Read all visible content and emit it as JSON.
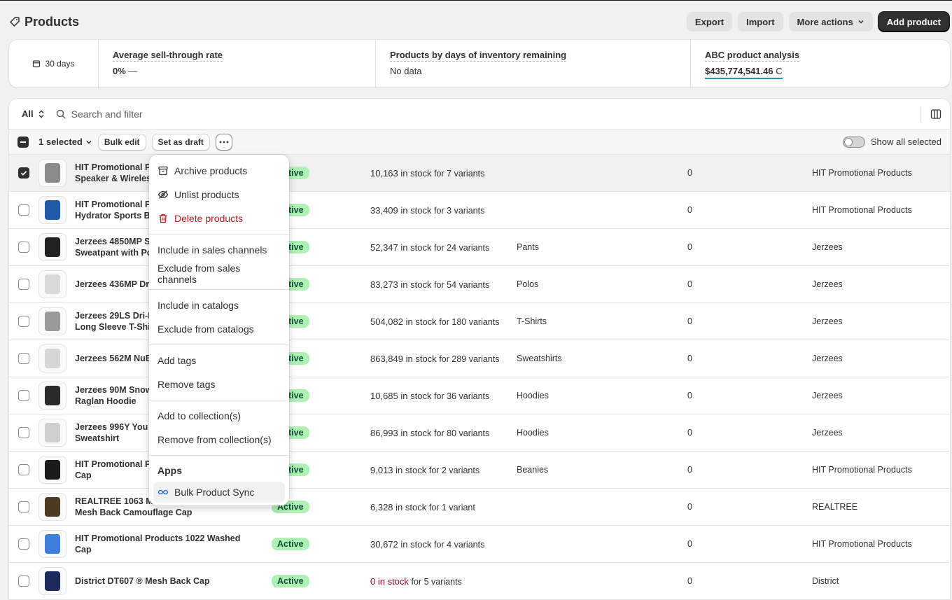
{
  "header": {
    "title": "Products",
    "export": "Export",
    "import": "Import",
    "more_actions": "More actions",
    "add_product": "Add product"
  },
  "metrics": {
    "period": "30 days",
    "sell_through_label": "Average sell-through rate",
    "sell_through_value": "0%",
    "sell_through_trend": "—",
    "days_inventory_label": "Products by days of inventory remaining",
    "days_inventory_value": "No data",
    "abc_label": "ABC product analysis",
    "abc_value": "$435,774,541.46",
    "abc_suffix": "C"
  },
  "filter": {
    "view_tab": "All",
    "search_placeholder": "Search and filter"
  },
  "bulk": {
    "selected": "1 selected",
    "bulk_edit": "Bulk edit",
    "set_draft": "Set as draft",
    "show_all": "Show all selected"
  },
  "rows": [
    {
      "name": "HIT Promotional Pr\nSpeaker & Wireles",
      "status": "Active",
      "stock": "10,163 in stock",
      "variants": "for 7 variants",
      "type": "",
      "channels": "0",
      "vendor": "HIT Promotional Products",
      "selected": true,
      "color": "#8a8a8a"
    },
    {
      "name": "HIT Promotional Pr\nHydrator Sports Bo",
      "status": "Active",
      "stock": "33,409 in stock",
      "variants": "for 3 variants",
      "type": "",
      "channels": "0",
      "vendor": "HIT Promotional Products",
      "selected": false,
      "color": "#1f5aa6"
    },
    {
      "name": "Jerzees 4850MP S\nSweatpant with Po",
      "status": "Active",
      "stock": "52,347 in stock",
      "variants": "for 24 variants",
      "type": "Pants",
      "channels": "0",
      "vendor": "Jerzees",
      "selected": false,
      "color": "#222222"
    },
    {
      "name": "Jerzees 436MP Dr",
      "status": "Active",
      "stock": "83,273 in stock",
      "variants": "for 54 variants",
      "type": "Polos",
      "channels": "0",
      "vendor": "Jerzees",
      "selected": false,
      "color": "#d9d9d9"
    },
    {
      "name": "Jerzees 29LS Dri-P\nLong Sleeve T-Shi",
      "status": "Active",
      "stock": "504,082 in stock",
      "variants": "for 180 variants",
      "type": "T-Shirts",
      "channels": "0",
      "vendor": "Jerzees",
      "selected": false,
      "color": "#9a9a9a"
    },
    {
      "name": "Jerzees 562M NuB",
      "status": "Active",
      "stock": "863,849 in stock",
      "variants": "for 289 variants",
      "type": "Sweatshirts",
      "channels": "0",
      "vendor": "Jerzees",
      "selected": false,
      "color": "#d6d6d6"
    },
    {
      "name": "Jerzees 90M Snow\nRaglan Hoodie",
      "status": "Active",
      "stock": "10,685 in stock",
      "variants": "for 36 variants",
      "type": "Hoodies",
      "channels": "0",
      "vendor": "Jerzees",
      "selected": false,
      "color": "#2b2b2b"
    },
    {
      "name": "Jerzees 996Y You\nSweatshirt",
      "status": "Active",
      "stock": "86,993 in stock",
      "variants": "for 80 variants",
      "type": "Hoodies",
      "channels": "0",
      "vendor": "Jerzees",
      "selected": false,
      "color": "#cfcfcf"
    },
    {
      "name": "HIT Promotional Pr\nCap",
      "status": "Active",
      "stock": "9,013 in stock",
      "variants": "for 2 variants",
      "type": "Beanies",
      "channels": "0",
      "vendor": "HIT Promotional Products",
      "selected": false,
      "color": "#1a1a1a"
    },
    {
      "name": "REALTREE 1063 Mo\nMesh Back Camouflage Cap",
      "status": "Active",
      "stock": "6,328 in stock",
      "variants": "for 1 variant",
      "type": "",
      "channels": "0",
      "vendor": "REALTREE",
      "selected": false,
      "color": "#4a3b22"
    },
    {
      "name": "HIT Promotional Products 1022 Washed Cap",
      "status": "Active",
      "stock": "30,672 in stock",
      "variants": "for 4 variants",
      "type": "",
      "channels": "0",
      "vendor": "HIT Promotional Products",
      "selected": false,
      "color": "#3d7fd6"
    },
    {
      "name": "District DT607 ® Mesh Back Cap",
      "status": "Active",
      "stock": "0 in stock",
      "variants": "for 5 variants",
      "type": "",
      "channels": "0",
      "vendor": "District",
      "selected": false,
      "color": "#1e2a5a",
      "zero": true
    }
  ],
  "menu": {
    "archive": "Archive products",
    "unlist": "Unlist products",
    "delete": "Delete products",
    "include_channels": "Include in sales channels",
    "exclude_channels": "Exclude from sales channels",
    "include_catalogs": "Include in catalogs",
    "exclude_catalogs": "Exclude from catalogs",
    "add_tags": "Add tags",
    "remove_tags": "Remove tags",
    "add_collection": "Add to collection(s)",
    "remove_collection": "Remove from collection(s)",
    "apps_heading": "Apps",
    "bulk_sync": "Bulk Product Sync"
  },
  "colors": {
    "danger": "#b32121",
    "status_bg": "#aff0b5",
    "accent_line": "#2c8bc4"
  }
}
